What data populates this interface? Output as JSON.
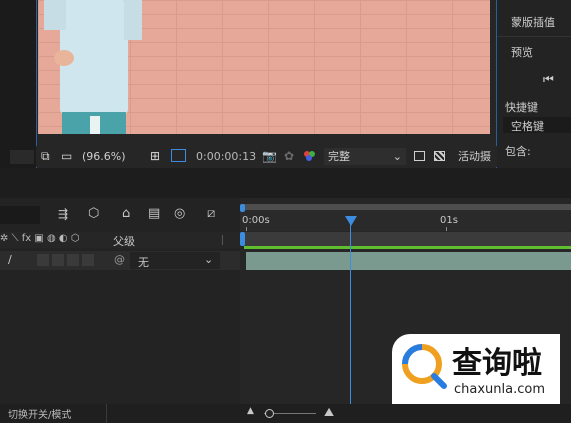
{
  "viewer": {
    "zoom": "(96.6%)",
    "timecode": "0:00:00:13",
    "resolution": "完整",
    "camera_label": "活动摄"
  },
  "right_panel": {
    "mask_interp": "蒙版插值",
    "preview": "预览",
    "shortcut_label": "快捷键",
    "shortcut_value": "空格键",
    "include_label": "包含:"
  },
  "timeline": {
    "time_start": "0:00s",
    "time_1s": "01s",
    "parent_header": "父级",
    "parent_value": "无",
    "toggle_modes": "切换开关/模式"
  },
  "watermark": {
    "name": "查询啦",
    "url": "chaxunla.com"
  },
  "colors": {
    "accent": "#3c8de0",
    "brick": "#e6a899",
    "green_bar": "#5fbf2f"
  }
}
